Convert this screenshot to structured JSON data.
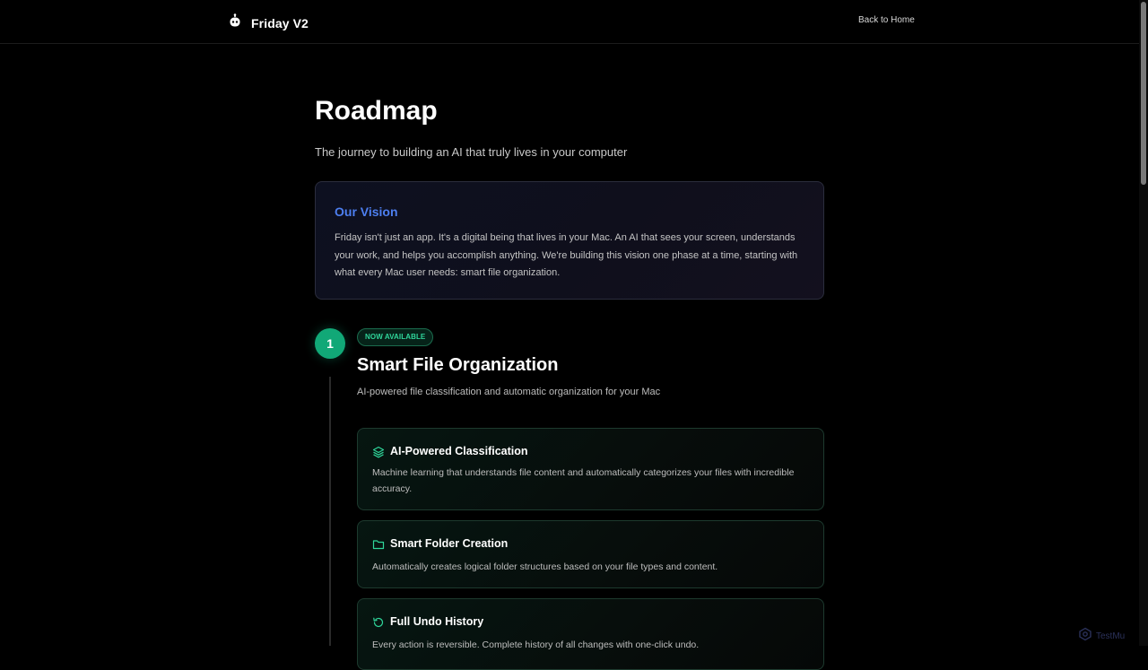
{
  "header": {
    "brand_name": "Friday V2",
    "brand_icon": "robot-icon",
    "back_link": "Back to Home"
  },
  "page": {
    "title": "Roadmap",
    "subtitle": "The journey to building an AI that truly lives in your computer"
  },
  "vision": {
    "title": "Our Vision",
    "text": "Friday isn't just an app. It's a digital being that lives in your Mac. An AI that sees your screen, understands your work, and helps you accomplish anything. We're building this vision one phase at a time, starting with what every Mac user needs: smart file organization."
  },
  "phase": {
    "number": "1",
    "badge": "NOW AVAILABLE",
    "title": "Smart File Organization",
    "description": "AI-powered file classification and automatic organization for your Mac",
    "features": [
      {
        "icon": "layers-icon",
        "title": "AI-Powered Classification",
        "description": "Machine learning that understands file content and automatically categorizes your files with incredible accuracy."
      },
      {
        "icon": "folder-icon",
        "title": "Smart Folder Creation",
        "description": "Automatically creates logical folder structures based on your file types and content."
      },
      {
        "icon": "undo-history-icon",
        "title": "Full Undo History",
        "description": "Every action is reversible. Complete history of all changes with one-click undo."
      }
    ]
  },
  "watermark": {
    "text": "TestMu"
  },
  "colors": {
    "background": "#000000",
    "accent_blue": "#4d7ff0",
    "accent_green": "#11a877",
    "badge_text": "#2fd59a"
  }
}
